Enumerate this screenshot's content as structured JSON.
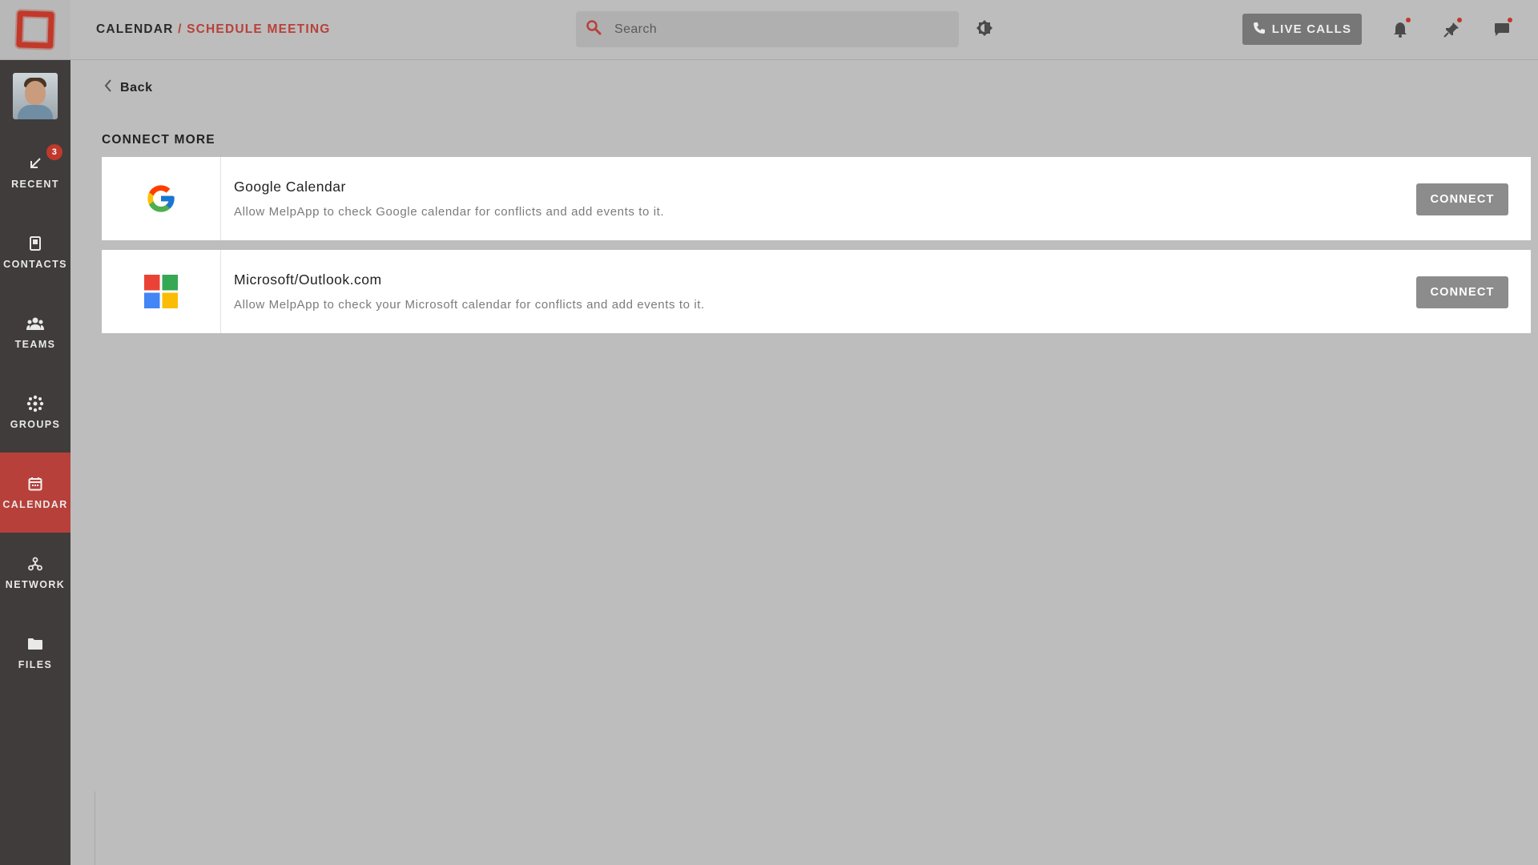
{
  "header": {
    "breadcrumb_root": "CALENDAR",
    "breadcrumb_sep": " / ",
    "breadcrumb_current": "SCHEDULE MEETING",
    "search_placeholder": "Search",
    "live_calls_label": "LIVE CALLS"
  },
  "sidebar": {
    "items": [
      {
        "label": "RECENT",
        "icon": "arrow-down-left-icon",
        "badge": "3"
      },
      {
        "label": "CONTACTS",
        "icon": "contacts-book-icon"
      },
      {
        "label": "TEAMS",
        "icon": "team-icon"
      },
      {
        "label": "GROUPS",
        "icon": "groups-icon"
      },
      {
        "label": "CALENDAR",
        "icon": "calendar-icon",
        "active": true
      },
      {
        "label": "NETWORK",
        "icon": "network-icon"
      },
      {
        "label": "FILES",
        "icon": "folder-icon"
      }
    ]
  },
  "main": {
    "back_label": "Back",
    "section_title": "CONNECT MORE",
    "cards": [
      {
        "title": "Google Calendar",
        "description": "Allow MelpApp to check Google calendar for conflicts and add events to it.",
        "button": "CONNECT",
        "icon": "google-logo-icon"
      },
      {
        "title": "Microsoft/Outlook.com",
        "description": "Allow MelpApp to check your Microsoft calendar for conflicts and add events to it.",
        "button": "CONNECT",
        "icon": "microsoft-logo-icon"
      }
    ]
  },
  "colors": {
    "accent": "#b7413a",
    "sidebar_bg": "#403c3c",
    "page_bg": "#bdbdbd"
  }
}
